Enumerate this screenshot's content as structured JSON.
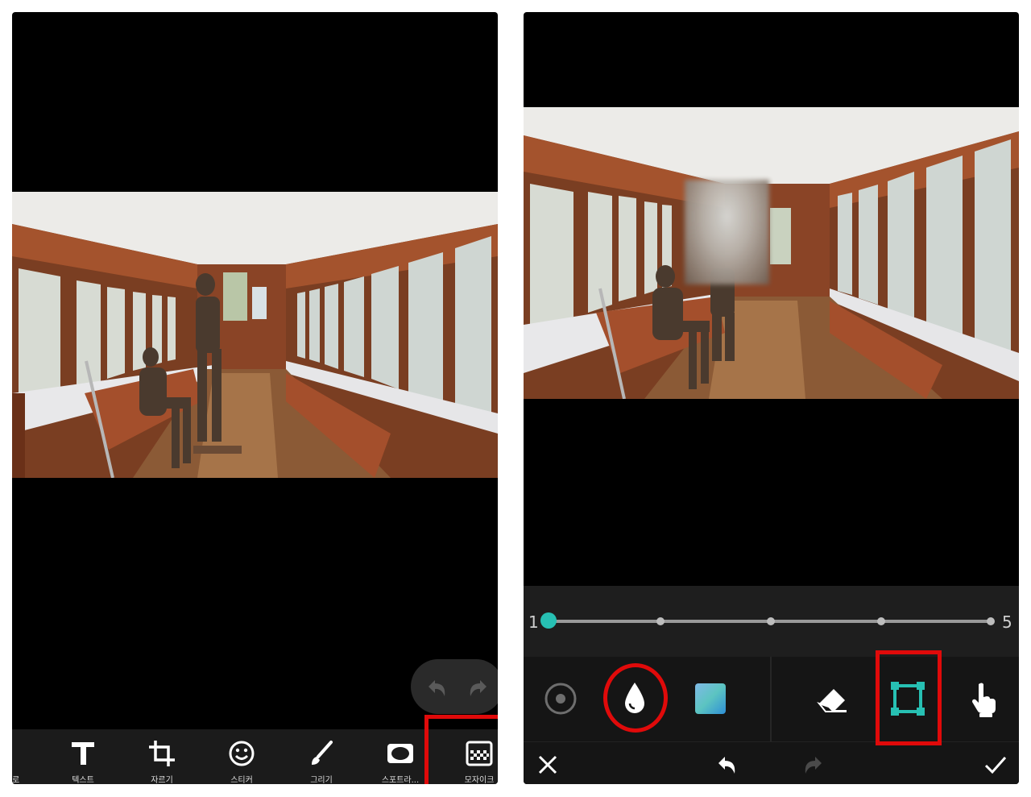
{
  "left_toolbar": {
    "tools": [
      {
        "label": "텍스트",
        "icon": "text-icon"
      },
      {
        "label": "자르기",
        "icon": "crop-icon"
      },
      {
        "label": "스티커",
        "icon": "sticker-icon"
      },
      {
        "label": "그리기",
        "icon": "brush-icon"
      },
      {
        "label": "스포트라...",
        "icon": "spotlight-icon"
      },
      {
        "label": "모자이크",
        "icon": "mosaic-icon"
      }
    ],
    "edge_label": "로"
  },
  "slider": {
    "min_label": "1",
    "max_label": "5",
    "value": 1,
    "steps": 5
  },
  "mode_tools": [
    "circle-mode-icon",
    "blur-drop-icon",
    "gradient-mosaic-icon",
    "eraser-icon",
    "rectangle-select-icon",
    "hand-touch-icon"
  ],
  "actions": [
    "close-icon",
    "undo-icon",
    "redo-icon",
    "confirm-icon"
  ],
  "colors": {
    "accent": "#27c0b3",
    "highlight": "#e00a0a",
    "toolbar_bg": "#1b1b1b",
    "wood": "#9b4f2b"
  }
}
